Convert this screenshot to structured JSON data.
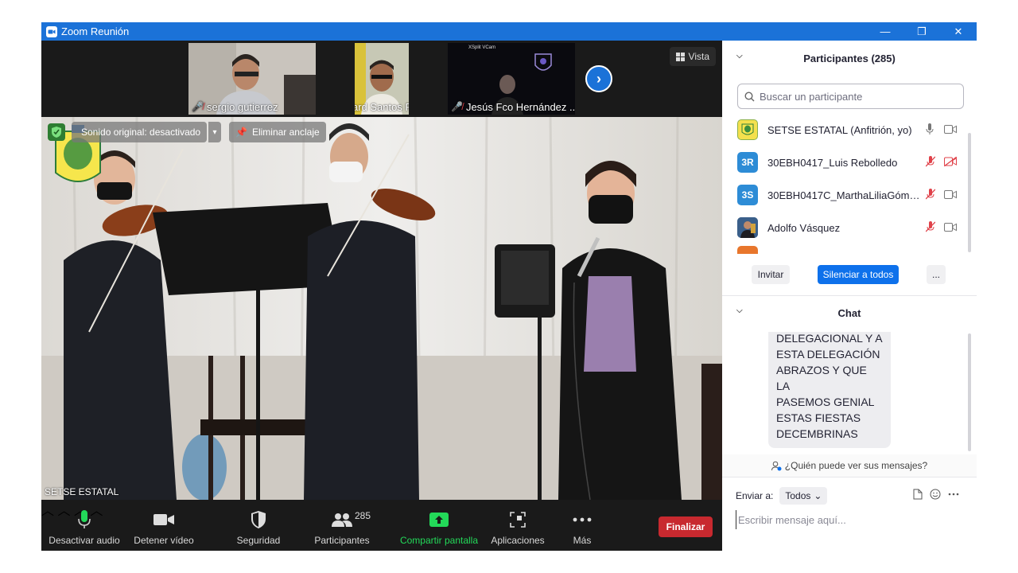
{
  "window": {
    "title": "Zoom Reunión",
    "minimize_glyph": "—",
    "restore_glyph": "❐",
    "close_glyph": "✕"
  },
  "strip": {
    "thumbnails": [
      {
        "name": "sergio gutierrez",
        "muted": true
      },
      {
        "name": "Richard Santos Pereyra",
        "muted": true
      },
      {
        "name": "Jesús Fco Hernández ...",
        "muted": true,
        "overlay_text": "XSplit VCam"
      }
    ],
    "next_icon": "chevron-right-icon",
    "view_label": "Vista"
  },
  "main": {
    "original_sound_label": "Sonido original: desactivado",
    "unpin_label": "Eliminar anclaje",
    "speaker_name": "SETSE ESTATAL"
  },
  "toolbar": {
    "mute_label": "Desactivar audio",
    "video_label": "Detener vídeo",
    "security_label": "Seguridad",
    "participants_label": "Participantes",
    "participants_count": "285",
    "share_label": "Compartir pantalla",
    "apps_label": "Aplicaciones",
    "more_label": "Más",
    "end_label": "Finalizar",
    "colors": {
      "share": "#23d959",
      "end": "#c8292f",
      "mic": "#23d959"
    }
  },
  "participants_panel": {
    "title": "Participantes (285)",
    "search_placeholder": "Buscar un participante",
    "list": [
      {
        "initials": "",
        "name": "SETSE ESTATAL (Anfitrión, yo)",
        "avatar_color": "#f4e04d",
        "mic_muted": false,
        "cam_off": false
      },
      {
        "initials": "3R",
        "name": "30EBH0417_Luis Rebolledo",
        "avatar_color": "#2d8cd6",
        "mic_muted": true,
        "cam_off": true
      },
      {
        "initials": "3S",
        "name": "30EBH0417C_MarthaLiliaGómez...",
        "avatar_color": "#2d8cd6",
        "mic_muted": true,
        "cam_off": false
      },
      {
        "initials": "",
        "name": "Adolfo Vásquez",
        "avatar_color": "#3a5f8a",
        "mic_muted": true,
        "cam_off": false
      }
    ],
    "invite_label": "Invitar",
    "mute_all_label": "Silenciar a todos",
    "more_label": "..."
  },
  "chat_panel": {
    "title": "Chat",
    "message_lines": [
      "DELEGACIONAL Y A",
      "ESTA DELEGACIÓN",
      "ABRAZOS Y QUE LA",
      "PASEMOS GENIAL",
      "ESTAS FIESTAS",
      "DECEMBRINAS"
    ],
    "who_can_see": "¿Quién puede ver sus mensajes?",
    "send_to_label": "Enviar a:",
    "send_to_value": "Todos",
    "input_placeholder": "Escribir mensaje aquí..."
  }
}
